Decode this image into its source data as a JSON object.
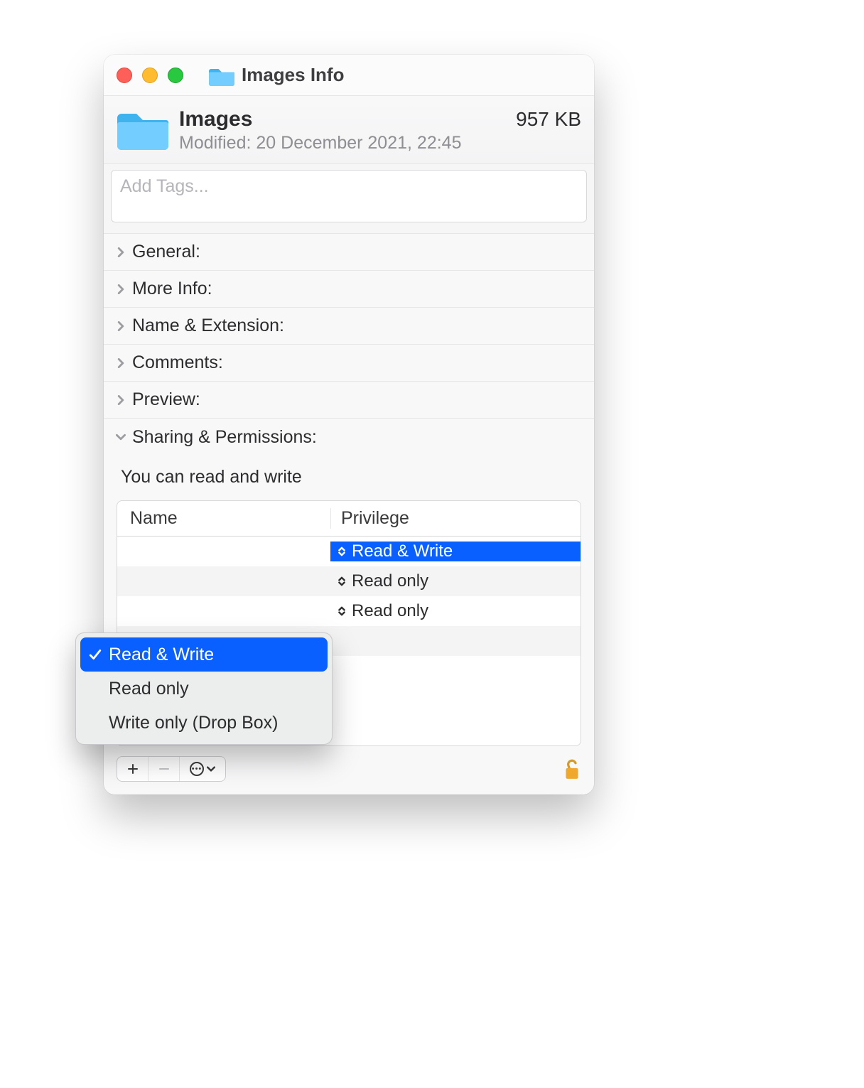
{
  "titlebar": {
    "title": "Images Info"
  },
  "header": {
    "name": "Images",
    "size": "957 KB",
    "modified": "Modified: 20 December 2021, 22:45"
  },
  "tags": {
    "placeholder": "Add Tags..."
  },
  "sections": {
    "general": "General:",
    "more_info": "More Info:",
    "name_ext": "Name & Extension:",
    "comments": "Comments:",
    "preview": "Preview:",
    "sharing": "Sharing & Permissions:"
  },
  "sharing": {
    "message": "You can read and write",
    "columns": {
      "name": "Name",
      "privilege": "Privilege"
    },
    "rows": [
      {
        "privilege": "Read & Write",
        "selected": true
      },
      {
        "privilege": "Read only",
        "selected": false
      },
      {
        "privilege": "Read only",
        "selected": false
      }
    ]
  },
  "menu": {
    "items": [
      {
        "label": "Read & Write",
        "checked": true
      },
      {
        "label": "Read only",
        "checked": false
      },
      {
        "label": "Write only (Drop Box)",
        "checked": false
      }
    ]
  }
}
